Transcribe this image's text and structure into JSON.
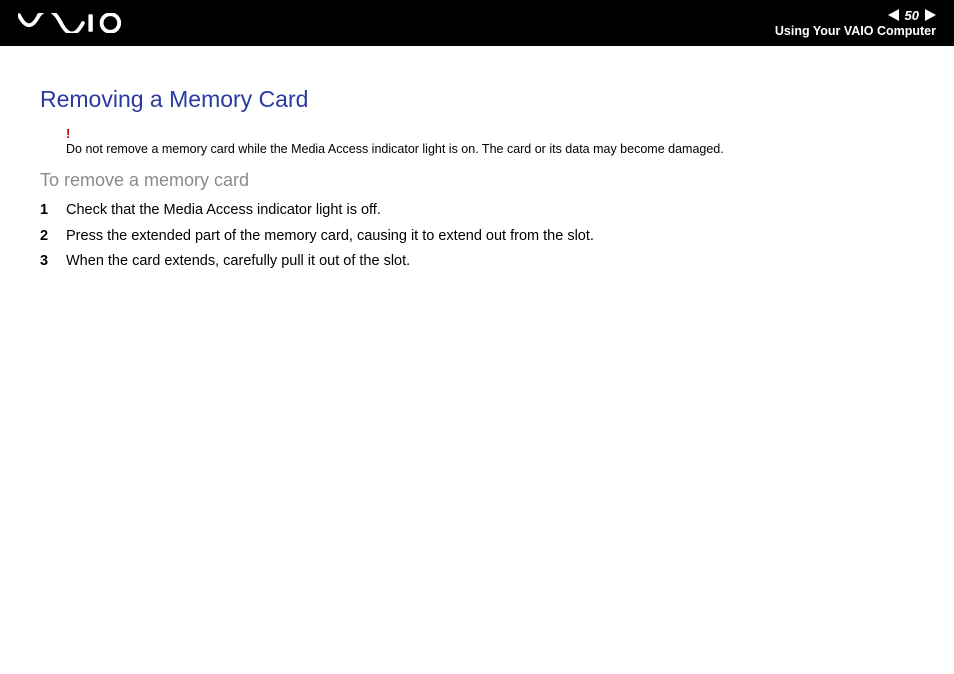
{
  "header": {
    "page_number": "50",
    "section": "Using Your VAIO Computer"
  },
  "title": "Removing a Memory Card",
  "warning": {
    "mark": "!",
    "text": "Do not remove a memory card while the Media Access indicator light is on. The card or its data may become damaged."
  },
  "subhead": "To remove a memory card",
  "steps": [
    {
      "num": "1",
      "text": "Check that the Media Access indicator light is off."
    },
    {
      "num": "2",
      "text": "Press the extended part of the memory card, causing it to extend out from the slot."
    },
    {
      "num": "3",
      "text": "When the card extends, carefully pull it out of the slot."
    }
  ]
}
